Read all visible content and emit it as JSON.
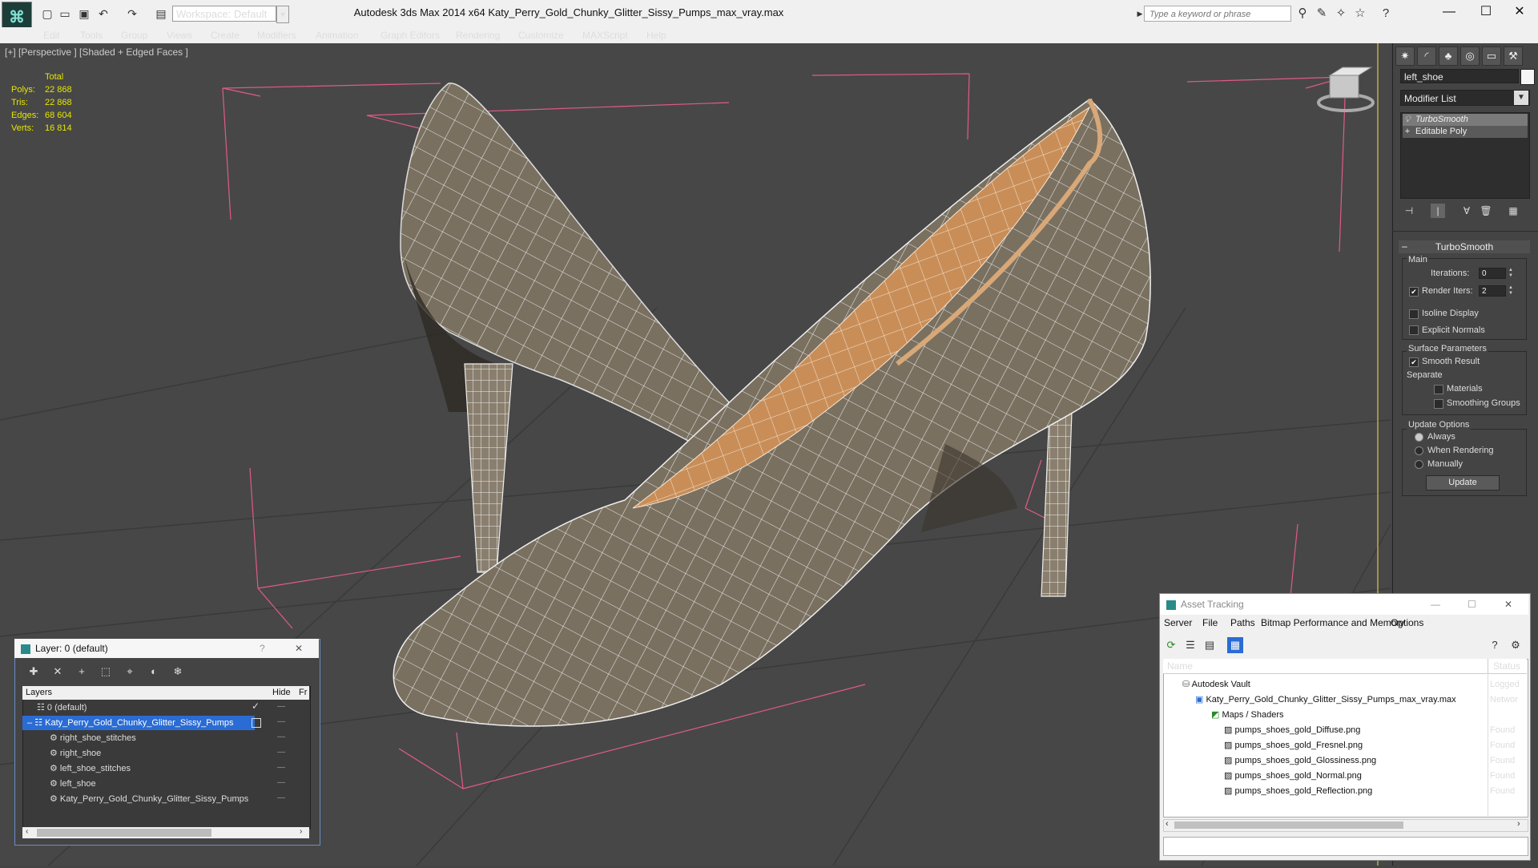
{
  "title_bar": {
    "app_title": "Autodesk 3ds Max  2014 x64      Katy_Perry_Gold_Chunky_Glitter_Sissy_Pumps_max_vray.max",
    "workspace": "Workspace: Default",
    "search_placeholder": "Type a keyword or phrase"
  },
  "menu": [
    "Edit",
    "Tools",
    "Group",
    "Views",
    "Create",
    "Modifiers",
    "Animation",
    "Graph Editors",
    "Rendering",
    "Customize",
    "MAXScript",
    "Help"
  ],
  "viewport": {
    "label": "[+] [Perspective ] [Shaded + Edged Faces ]",
    "stats": {
      "header": "Total",
      "rows": [
        {
          "label": "Polys:",
          "value": "22 868"
        },
        {
          "label": "Tris:",
          "value": "22 868"
        },
        {
          "label": "Edges:",
          "value": "68 604"
        },
        {
          "label": "Verts:",
          "value": "16 814"
        }
      ]
    }
  },
  "command_panel": {
    "object_name": "left_shoe",
    "modifier_list": "Modifier List",
    "stack": [
      "TurboSmooth",
      "Editable Poly"
    ],
    "turbosmooth": {
      "title": "TurboSmooth",
      "main": "Main",
      "iterations_label": "Iterations:",
      "iterations": "0",
      "render_iters_label": "Render Iters:",
      "render_iters": "2",
      "isoline": "Isoline Display",
      "explicit_normals": "Explicit Normals",
      "surface_params": "Surface Parameters",
      "smooth_result": "Smooth Result",
      "separate": "Separate",
      "materials": "Materials",
      "smoothing_groups": "Smoothing Groups",
      "update_options": "Update Options",
      "always": "Always",
      "when_rendering": "When Rendering",
      "manually": "Manually",
      "update": "Update"
    }
  },
  "layer_dialog": {
    "title": "Layer: 0 (default)",
    "header_layers": "Layers",
    "header_hide": "Hide",
    "header_fr": "Fr",
    "rows": [
      {
        "name": "0 (default)",
        "indent": 0
      },
      {
        "name": "Katy_Perry_Gold_Chunky_Glitter_Sissy_Pumps",
        "indent": 0
      },
      {
        "name": "right_shoe_stitches",
        "indent": 1
      },
      {
        "name": "right_shoe",
        "indent": 1
      },
      {
        "name": "left_shoe_stitches",
        "indent": 1
      },
      {
        "name": "left_shoe",
        "indent": 1
      },
      {
        "name": "Katy_Perry_Gold_Chunky_Glitter_Sissy_Pumps",
        "indent": 1
      }
    ]
  },
  "asset_dialog": {
    "title": "Asset Tracking",
    "menu": [
      "Server",
      "File",
      "Paths",
      "Bitmap Performance and Memory",
      "Options"
    ],
    "header_name": "Name",
    "header_status": "Status",
    "rows": [
      {
        "name": "Autodesk Vault",
        "status": "Logged"
      },
      {
        "name": "Katy_Perry_Gold_Chunky_Glitter_Sissy_Pumps_max_vray.max",
        "status": "Networ"
      },
      {
        "name": "Maps / Shaders",
        "status": ""
      },
      {
        "name": "pumps_shoes_gold_Diffuse.png",
        "status": "Found"
      },
      {
        "name": "pumps_shoes_gold_Fresnel.png",
        "status": "Found"
      },
      {
        "name": "pumps_shoes_gold_Glossiness.png",
        "status": "Found"
      },
      {
        "name": "pumps_shoes_gold_Normal.png",
        "status": "Found"
      },
      {
        "name": "pumps_shoes_gold_Reflection.png",
        "status": "Found"
      }
    ]
  },
  "colors": {
    "viewport_bg": "#474747",
    "stats_text": "#e6e600",
    "selection": "#2a6cd4",
    "shoe_fabric": "#7a7060",
    "shoe_lining": "#d4a070"
  }
}
